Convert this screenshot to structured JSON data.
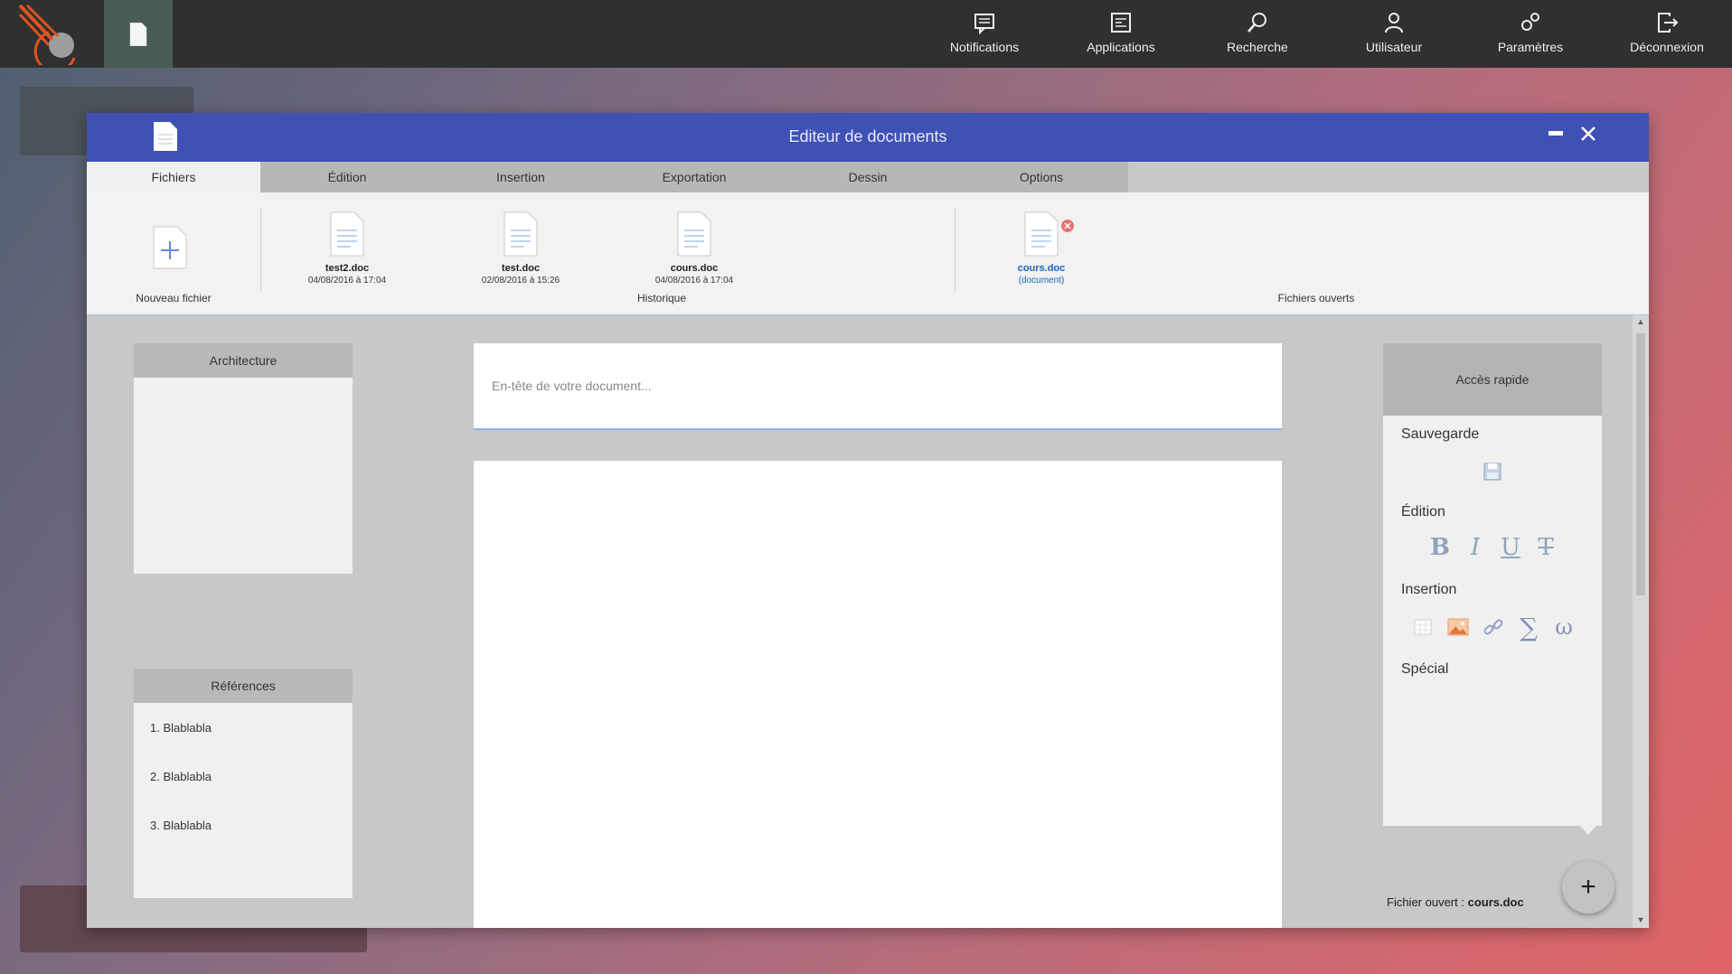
{
  "topbar": {
    "nav": [
      {
        "label": "Notifications",
        "icon": "notifications-icon"
      },
      {
        "label": "Applications",
        "icon": "applications-icon"
      },
      {
        "label": "Recherche",
        "icon": "search-icon"
      },
      {
        "label": "Utilisateur",
        "icon": "user-icon"
      },
      {
        "label": "Paramètres",
        "icon": "settings-icon"
      },
      {
        "label": "Déconnexion",
        "icon": "logout-icon"
      }
    ]
  },
  "window": {
    "title": "Editeur de documents",
    "tabs": [
      "Fichiers",
      "Édition",
      "Insertion",
      "Exportation",
      "Dessin",
      "Options"
    ],
    "active_tab": "Fichiers"
  },
  "ribbon": {
    "new_file_label": "Nouveau fichier",
    "history_label": "Historique",
    "open_files_label": "Fichiers ouverts",
    "history": [
      {
        "name": "test2.doc",
        "date": "04/08/2016 à 17:04"
      },
      {
        "name": "test.doc",
        "date": "02/08/2016 à 15:26"
      },
      {
        "name": "cours.doc",
        "date": "04/08/2016 à 17:04"
      }
    ],
    "open_files": [
      {
        "name": "cours.doc",
        "type": "(document)"
      }
    ]
  },
  "left": {
    "architecture_title": "Architecture",
    "references_title": "Références",
    "references": [
      "1. Blablabla",
      "2. Blablabla",
      "3. Blablabla"
    ]
  },
  "editor": {
    "header_placeholder": "En-tête de votre document..."
  },
  "quick_access": {
    "title": "Accès rapide",
    "sections": {
      "save": "Sauvegarde",
      "edit": "Édition",
      "insert": "Insertion",
      "special": "Spécial"
    },
    "format_letters": [
      "B",
      "I",
      "U",
      "T"
    ]
  },
  "status": {
    "open_file_prefix": "Fichier ouvert : ",
    "open_file_name": "cours.doc"
  },
  "colors": {
    "titlebar": "#3f51b5",
    "topbar": "#2f3030",
    "accent_link": "#1565c0"
  }
}
